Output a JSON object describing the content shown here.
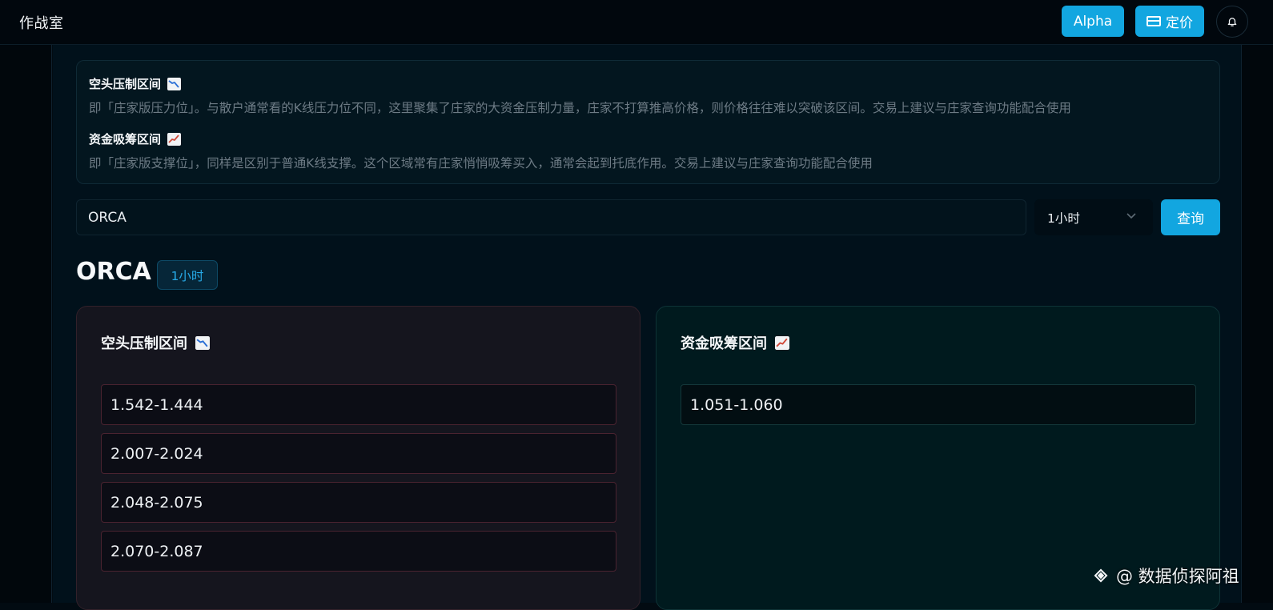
{
  "header": {
    "app_title": "作战室",
    "alpha_label": "Alpha",
    "pricing_label": "定价"
  },
  "info": {
    "short_title": "空头压制区间",
    "short_desc": "即「庄家版压力位」。与散户通常看的K线压力位不同，这里聚集了庄家的大资金压制力量，庄家不打算推高价格，则价格往往难以突破该区间。交易上建议与庄家查询功能配合使用",
    "long_title": "资金吸筹区间",
    "long_desc": "即「庄家版支撑位」，同样是区别于普通K线支撑。这个区域常有庄家悄悄吸筹买入，通常会起到托底作用。交易上建议与庄家查询功能配合使用"
  },
  "query": {
    "symbol_value": "ORCA",
    "timeframe": "1小时",
    "submit_label": "查询"
  },
  "result": {
    "symbol": "ORCA",
    "timeframe_badge": "1小时",
    "short_card_title": "空头压制区间",
    "long_card_title": "资金吸筹区间",
    "short_zones": [
      "1.542-1.444",
      "2.007-2.024",
      "2.048-2.075",
      "2.070-2.087"
    ],
    "long_zones": [
      "1.051-1.060"
    ]
  },
  "watermark": {
    "text": "@ 数据侦探阿祖"
  },
  "icons": {
    "short_emoji": "chart-decreasing-icon",
    "long_emoji": "chart-increasing-icon",
    "pricing": "credit-card-icon",
    "bell": "bell-icon",
    "select": "chevron-down-icon",
    "watermark": "diamond-logo-icon"
  },
  "colors": {
    "accent": "#12a6e0",
    "short_card_border": "#4a2330",
    "long_card_border": "#14383a",
    "short_emoji_stroke": "#2a6fd6",
    "long_emoji_stroke": "#d04a3a"
  }
}
